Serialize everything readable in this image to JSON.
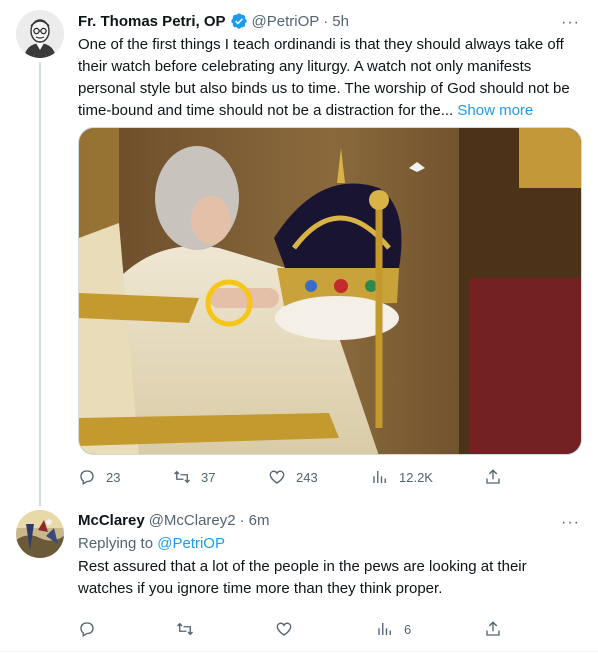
{
  "tweet": {
    "author_name": "Fr. Thomas Petri, OP",
    "handle": "@PetriOP",
    "separator": "·",
    "time": "5h",
    "text": "One of the first things I teach ordinandi is that they should always take off their watch before celebrating any liturgy. A watch not only manifests personal style but also binds us to time. The worship of God should not be time-bound and time should not be a distraction for the...",
    "show_more": "Show more",
    "stats": {
      "replies": "23",
      "retweets": "37",
      "likes": "243",
      "views": "12.2K"
    },
    "more_label": "···"
  },
  "reply": {
    "author_name": "McClarey",
    "handle": "@McClarey2",
    "separator": "·",
    "time": "6m",
    "replying_prefix": "Replying to",
    "replying_to": "@PetriOP",
    "text": "Rest assured that a lot of the people in the pews are looking at their watches if you ignore time more than they think proper.",
    "stats": {
      "replies": "",
      "retweets": "",
      "likes": "",
      "views": "6"
    },
    "more_label": "···"
  },
  "colors": {
    "accent": "#1d9bf0",
    "muted": "#536471",
    "highlight_ring": "#f5c518"
  },
  "icons": [
    "verified-badge-icon",
    "reply-icon",
    "retweet-icon",
    "like-icon",
    "views-icon",
    "share-icon",
    "more-icon"
  ]
}
